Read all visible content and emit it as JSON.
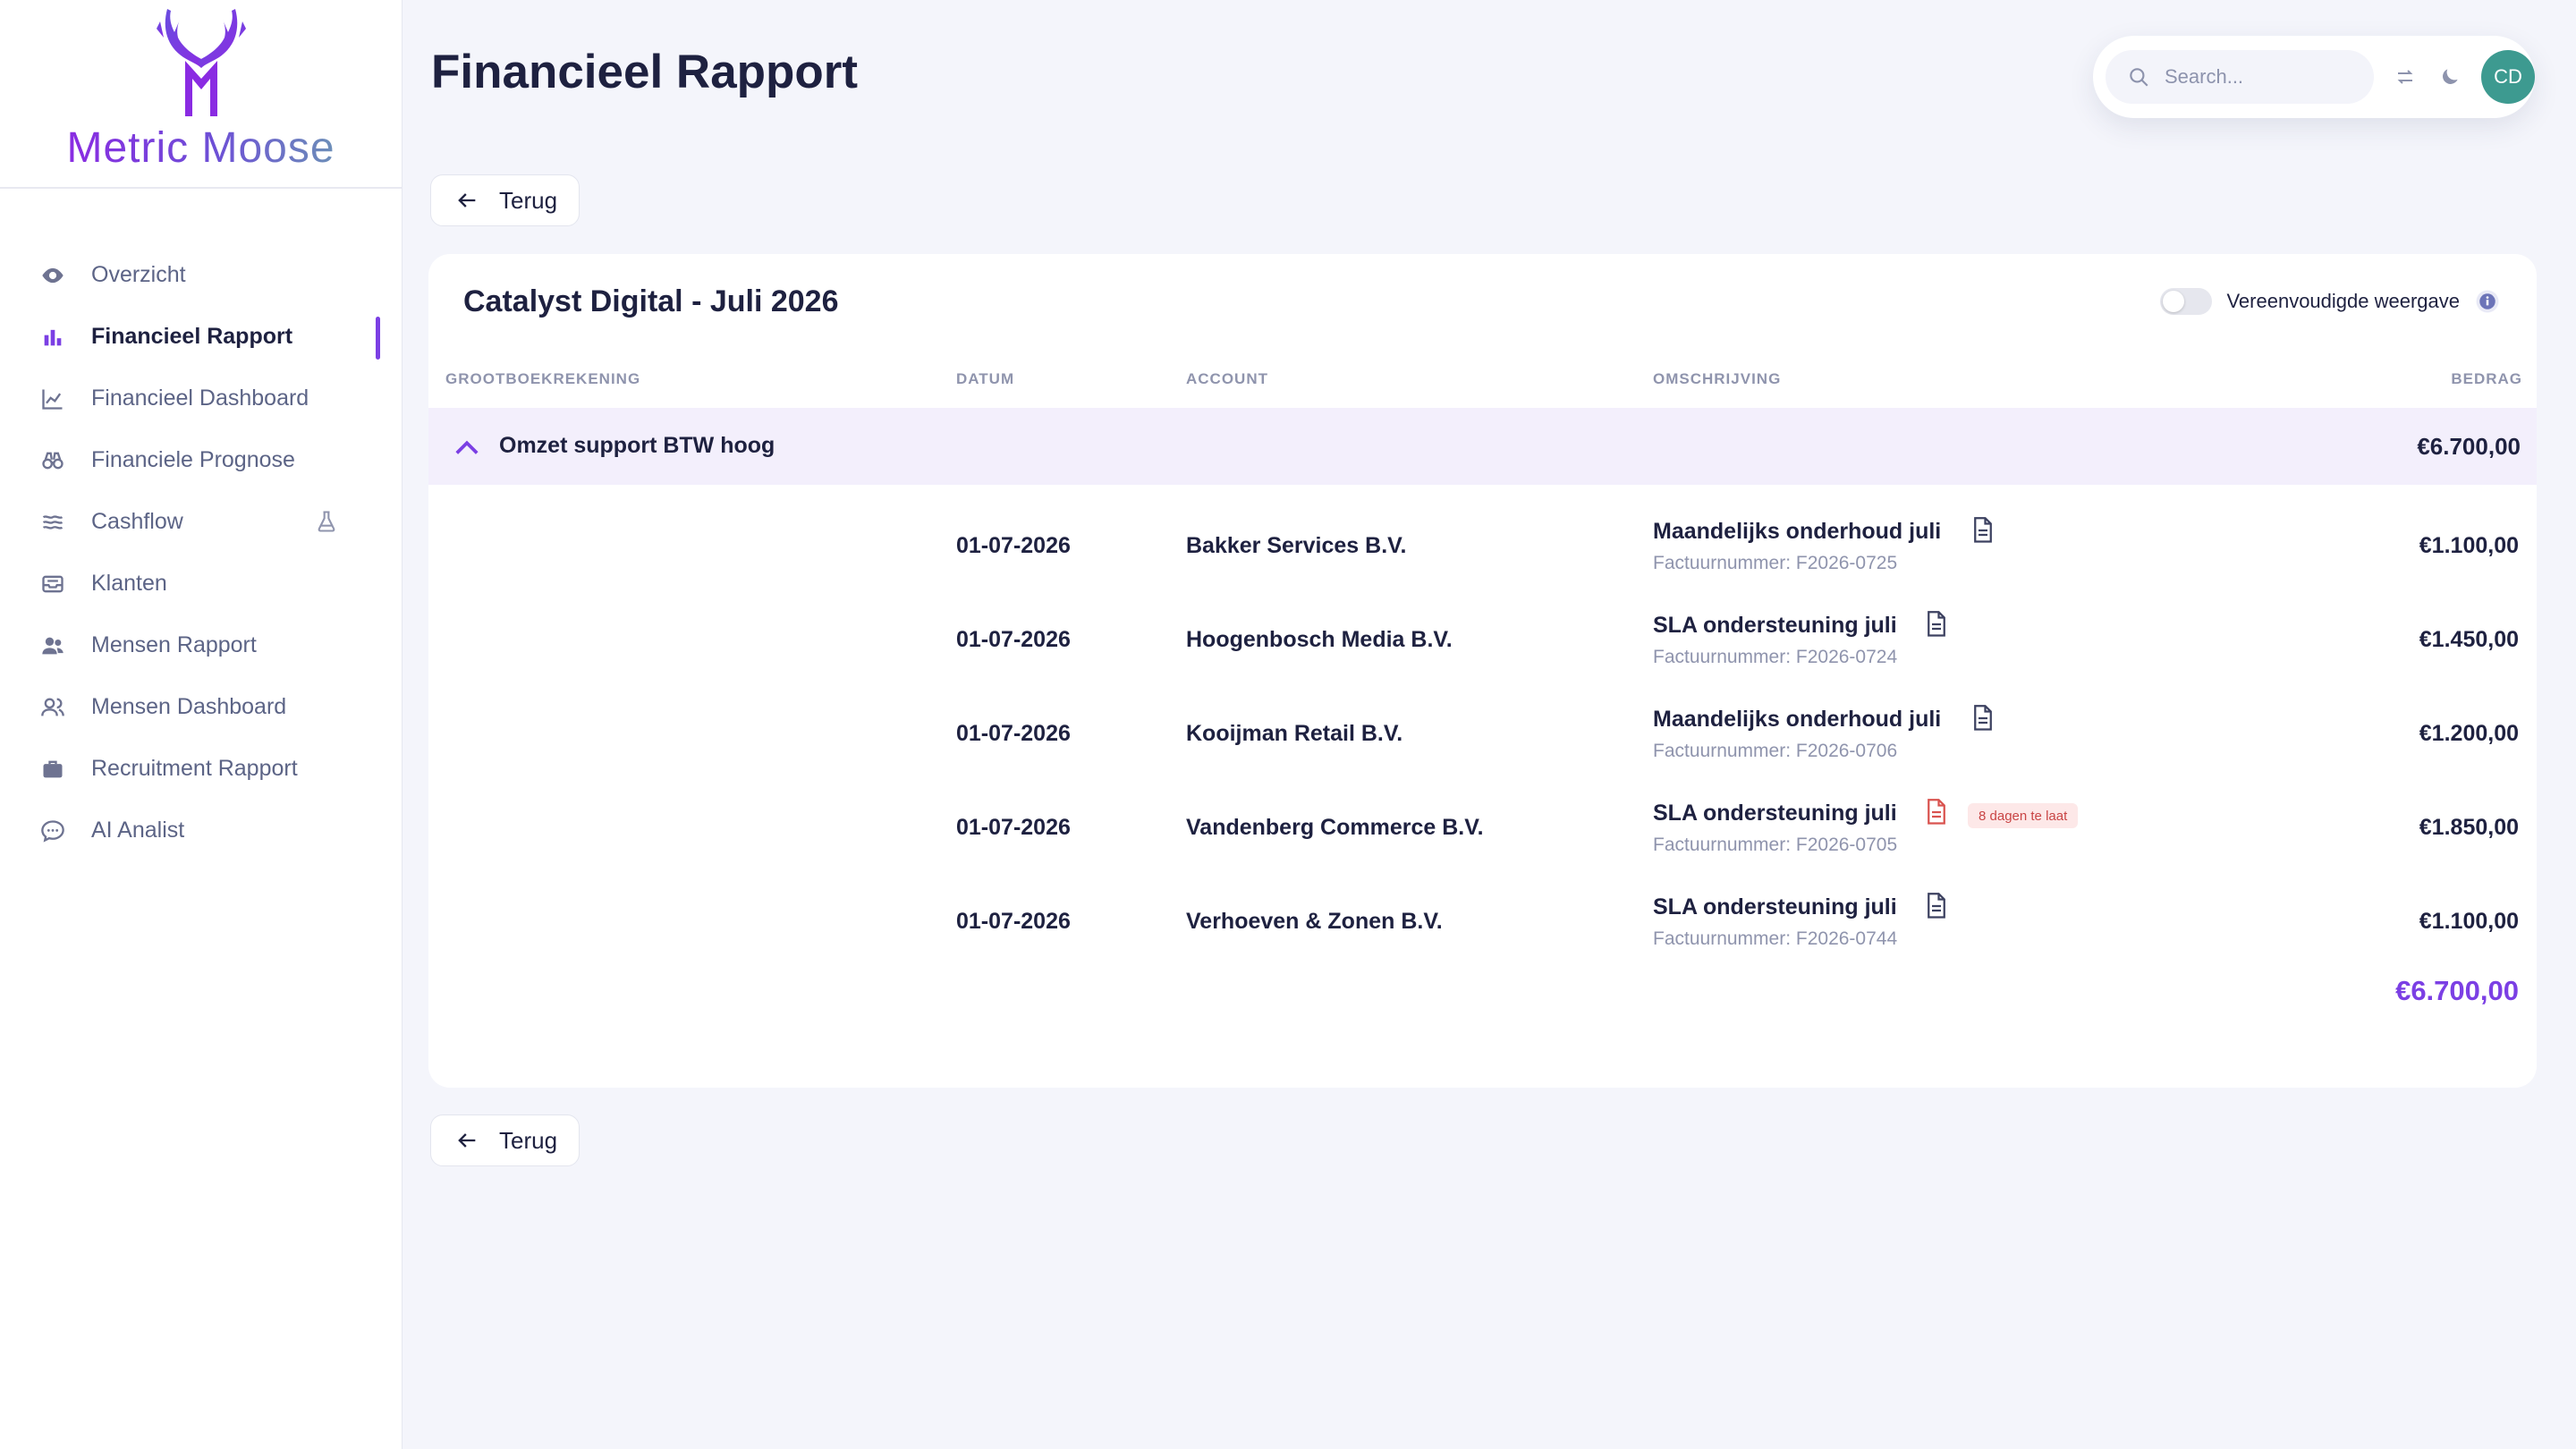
{
  "app": {
    "logo_text": "Metric Moose",
    "page_title": "Financieel Rapport"
  },
  "sidebar": {
    "items": [
      {
        "label": "Overzicht",
        "icon": "eye-icon"
      },
      {
        "label": "Financieel Rapport",
        "icon": "bar-chart-icon",
        "active": true
      },
      {
        "label": "Financieel Dashboard",
        "icon": "line-chart-icon"
      },
      {
        "label": "Financiele Prognose",
        "icon": "binoculars-icon"
      },
      {
        "label": "Cashflow",
        "icon": "waves-icon",
        "badge_icon": "flask-icon"
      },
      {
        "label": "Klanten",
        "icon": "inbox-icon"
      },
      {
        "label": "Mensen Rapport",
        "icon": "users-icon"
      },
      {
        "label": "Mensen Dashboard",
        "icon": "users-outline-icon"
      },
      {
        "label": "Recruitment Rapport",
        "icon": "briefcase-icon"
      },
      {
        "label": "AI Analist",
        "icon": "chat-bubble-icon"
      }
    ]
  },
  "topbar": {
    "search_placeholder": "Search...",
    "avatar_initials": "CD"
  },
  "buttons": {
    "back_label": "Terug"
  },
  "card": {
    "title": "Catalyst Digital - Juli 2026",
    "toggle_label": "Vereenvoudigde weergave",
    "columns": {
      "ledger": "Grootboekrekening",
      "date": "Datum",
      "account": "Account",
      "description": "Omschrijving",
      "amount": "Bedrag"
    },
    "group": {
      "label": "Omzet support BTW hoog",
      "amount": "€6.700,00"
    },
    "rows": [
      {
        "date": "01-07-2026",
        "account": "Bakker Services B.V.",
        "description": "Maandelijks onderhoud juli",
        "invoice": "Factuurnummer: F2026-0725",
        "amount": "€1.100,00",
        "late": ""
      },
      {
        "date": "01-07-2026",
        "account": "Hoogenbosch Media B.V.",
        "description": "SLA ondersteuning juli",
        "invoice": "Factuurnummer: F2026-0724",
        "amount": "€1.450,00",
        "late": ""
      },
      {
        "date": "01-07-2026",
        "account": "Kooijman Retail B.V.",
        "description": "Maandelijks onderhoud juli",
        "invoice": "Factuurnummer: F2026-0706",
        "amount": "€1.200,00",
        "late": ""
      },
      {
        "date": "01-07-2026",
        "account": "Vandenberg Commerce B.V.",
        "description": "SLA ondersteuning juli",
        "invoice": "Factuurnummer: F2026-0705",
        "amount": "€1.850,00",
        "late": "8 dagen te laat"
      },
      {
        "date": "01-07-2026",
        "account": "Verhoeven & Zonen B.V.",
        "description": "SLA ondersteuning juli",
        "invoice": "Factuurnummer: F2026-0744",
        "amount": "€1.100,00",
        "late": ""
      }
    ],
    "total": "€6.700,00"
  },
  "colors": {
    "accent": "#7b3fe4",
    "avatar": "#3d9a90",
    "late_badge_bg": "#fde8e8",
    "late_badge_text": "#c94545"
  }
}
